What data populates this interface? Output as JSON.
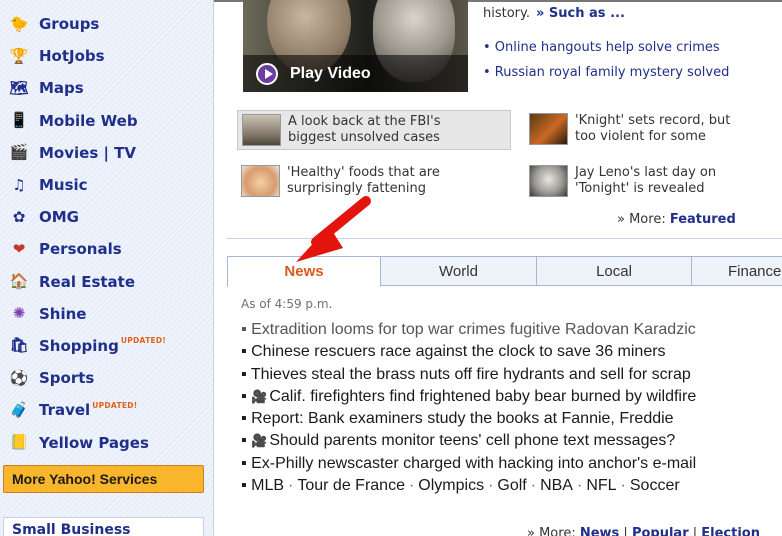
{
  "sidebar": {
    "items": [
      {
        "label": "Groups",
        "icon": "groups-icon",
        "glyph": "🐤"
      },
      {
        "label": "HotJobs",
        "icon": "hotjobs-icon",
        "glyph": "🏆"
      },
      {
        "label": "Maps",
        "icon": "maps-icon",
        "glyph": "🗺"
      },
      {
        "label": "Mobile Web",
        "icon": "mobile-icon",
        "glyph": "📱"
      },
      {
        "label": "Movies | TV",
        "icon": "movies-icon",
        "glyph": "🎬"
      },
      {
        "label": "Music",
        "icon": "music-icon",
        "glyph": "♫"
      },
      {
        "label": "OMG",
        "icon": "omg-icon",
        "glyph": "✿"
      },
      {
        "label": "Personals",
        "icon": "personals-icon",
        "glyph": "❤"
      },
      {
        "label": "Real Estate",
        "icon": "realestate-icon",
        "glyph": "🏠"
      },
      {
        "label": "Shine",
        "icon": "shine-icon",
        "glyph": "✺"
      },
      {
        "label": "Shopping",
        "icon": "shopping-icon",
        "glyph": "🛍",
        "badge": "UPDATED!"
      },
      {
        "label": "Sports",
        "icon": "sports-icon",
        "glyph": "⚽"
      },
      {
        "label": "Travel",
        "icon": "travel-icon",
        "glyph": "🧳",
        "badge": "UPDATED!"
      },
      {
        "label": "Yellow Pages",
        "icon": "yellowpages-icon",
        "glyph": "📒"
      }
    ],
    "more_services": "More Yahoo! Services",
    "small_business": "Small Business"
  },
  "featured": {
    "video_label": "Play Video",
    "history_text": "history.",
    "such_as": "» Such as ...",
    "bullets": [
      "• Online hangouts help solve crimes",
      "• Russian royal family mystery solved"
    ],
    "stories": [
      {
        "line1": "A look back at the FBI's",
        "line2": "biggest unsolved cases"
      },
      {
        "line1": "'Knight' sets record, but",
        "line2": "too violent for some"
      },
      {
        "line1": "'Healthy' foods that are",
        "line2": "surprisingly fattening"
      },
      {
        "line1": "Jay Leno's last day on",
        "line2": "'Tonight' is revealed"
      }
    ],
    "more_prefix": "» More:",
    "more_link": "Featured"
  },
  "tabs": [
    "News",
    "World",
    "Local",
    "Finance"
  ],
  "news": {
    "as_of": "As of 4:59 p.m.",
    "items": [
      "Extradition looms for top war crimes fugitive Radovan Karadzic",
      "Chinese rescuers race against the clock to save 36 miners",
      "Thieves steal the brass nuts off fire hydrants and sell for scrap",
      "Calif. firefighters find frightened baby bear burned by wildfire",
      "Report: Bank examiners study the books at Fannie, Freddie",
      "Should parents monitor teens' cell phone text messages?",
      "Ex-Philly newscaster charged with hacking into anchor's e-mail"
    ],
    "sports_links": [
      "MLB",
      "Tour de France",
      "Olympics",
      "Golf",
      "NBA",
      "NFL",
      "Soccer"
    ],
    "more_prefix": "» More:",
    "more_links": [
      "News",
      "Popular",
      "Election"
    ]
  },
  "colors": {
    "link_blue": "#1f2f8a",
    "tab_active_orange": "#d85a1b",
    "services_button": "#f9b52c",
    "annotation_red": "#e3130e"
  }
}
